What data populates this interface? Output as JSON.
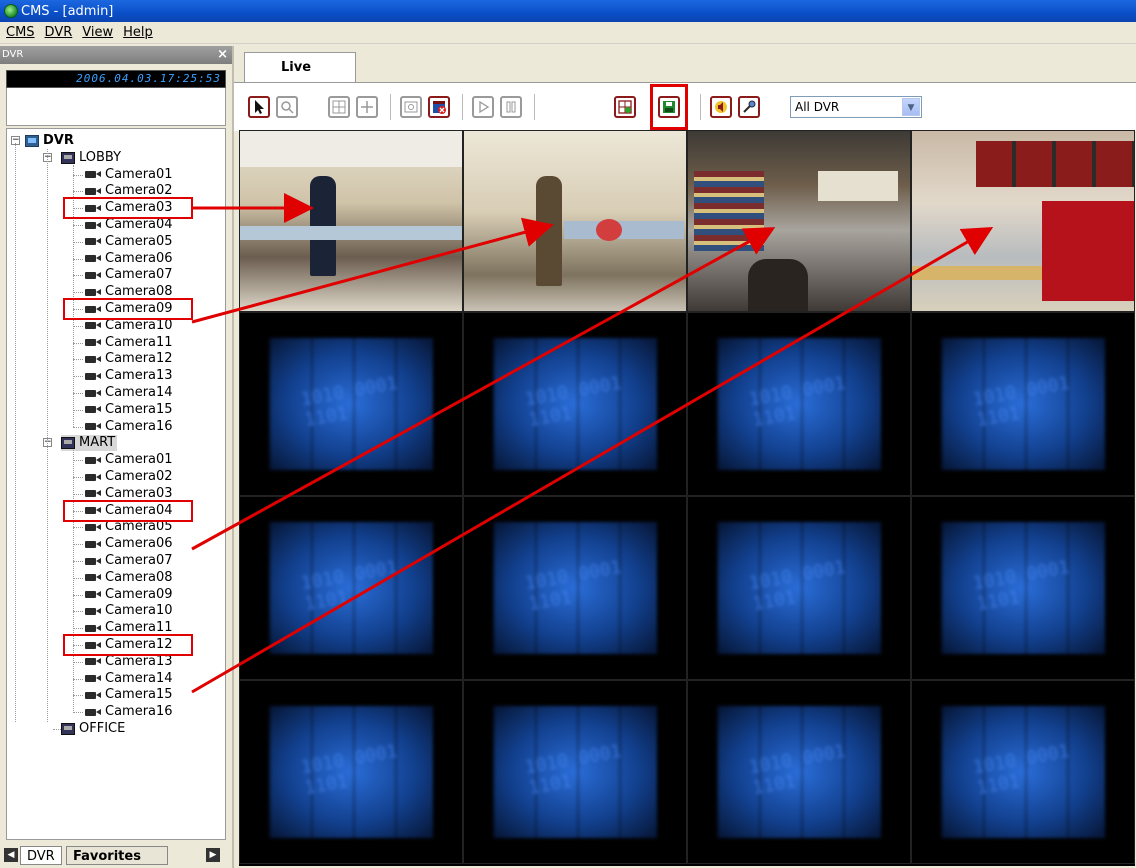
{
  "window": {
    "title": "CMS - [admin]"
  },
  "menu": [
    "CMS",
    "DVR",
    "View",
    "Help"
  ],
  "left_panel": {
    "header": "DVR",
    "close_glyph": "×",
    "clock": "2006.04.03.17:25:53",
    "tree": {
      "root": "DVR",
      "groups": [
        {
          "name": "LOBBY",
          "cameras": [
            "Camera01",
            "Camera02",
            "Camera03",
            "Camera04",
            "Camera05",
            "Camera06",
            "Camera07",
            "Camera08",
            "Camera09",
            "Camera10",
            "Camera11",
            "Camera12",
            "Camera13",
            "Camera14",
            "Camera15",
            "Camera16"
          ]
        },
        {
          "name": "MART",
          "cameras": [
            "Camera01",
            "Camera02",
            "Camera03",
            "Camera04",
            "Camera05",
            "Camera06",
            "Camera07",
            "Camera08",
            "Camera09",
            "Camera10",
            "Camera11",
            "Camera12",
            "Camera13",
            "Camera14",
            "Camera15",
            "Camera16"
          ]
        },
        {
          "name": "OFFICE",
          "cameras": []
        }
      ]
    },
    "tabs": [
      "DVR",
      "Favorites"
    ]
  },
  "main": {
    "tab": "Live",
    "toolbar": {
      "buttons": [
        "select-icon",
        "zoom-icon",
        "layout-icon",
        "move-icon",
        "snapshot-icon",
        "delete-icon",
        "play-icon",
        "pause-icon",
        "layout-add-icon",
        "save-icon",
        "audio-icon",
        "mic-icon"
      ],
      "dvr_select": "All DVR"
    },
    "grid": {
      "rows": 4,
      "cols": 4,
      "live_cells": 4,
      "nosignal_text": "1010 0001 1101"
    }
  },
  "colors": {
    "highlight": "#e00000",
    "titlebar": "#0a4fc8",
    "clock_text": "#3aa0ff"
  }
}
